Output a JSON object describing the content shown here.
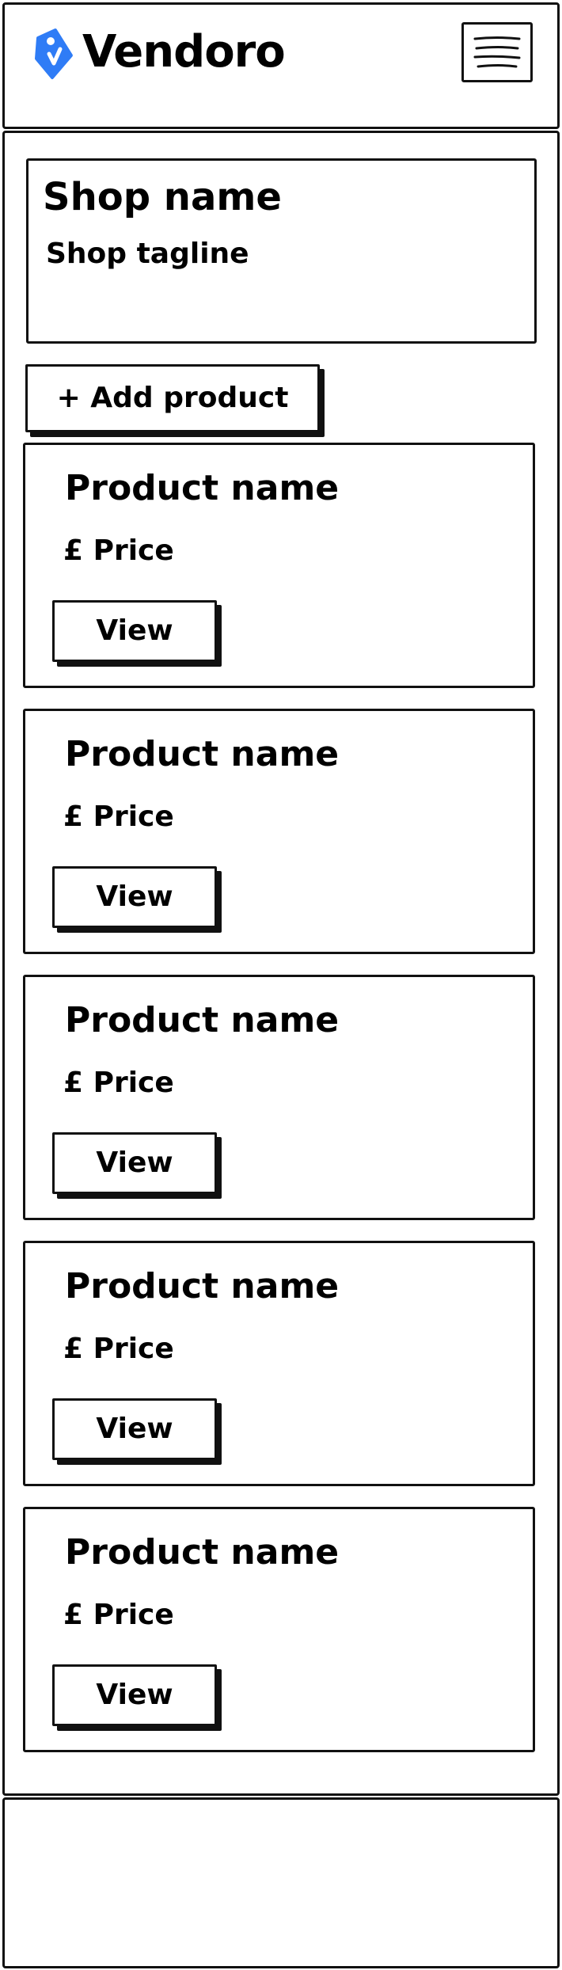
{
  "header": {
    "brand": "Vendoro",
    "logo_icon": "price-tag-icon",
    "menu_icon": "hamburger-menu-icon"
  },
  "shop": {
    "name": "Shop name",
    "tagline": "Shop tagline"
  },
  "actions": {
    "add_product_label": "+ Add product"
  },
  "products": [
    {
      "name": "Product name",
      "price": "£ Price",
      "view_label": "View"
    },
    {
      "name": "Product name",
      "price": "£ Price",
      "view_label": "View"
    },
    {
      "name": "Product name",
      "price": "£ Price",
      "view_label": "View"
    },
    {
      "name": "Product name",
      "price": "£ Price",
      "view_label": "View"
    },
    {
      "name": "Product name",
      "price": "£ Price",
      "view_label": "View"
    }
  ],
  "colors": {
    "logo": "#2f7cf6",
    "ink": "#111111",
    "background": "#ffffff"
  }
}
